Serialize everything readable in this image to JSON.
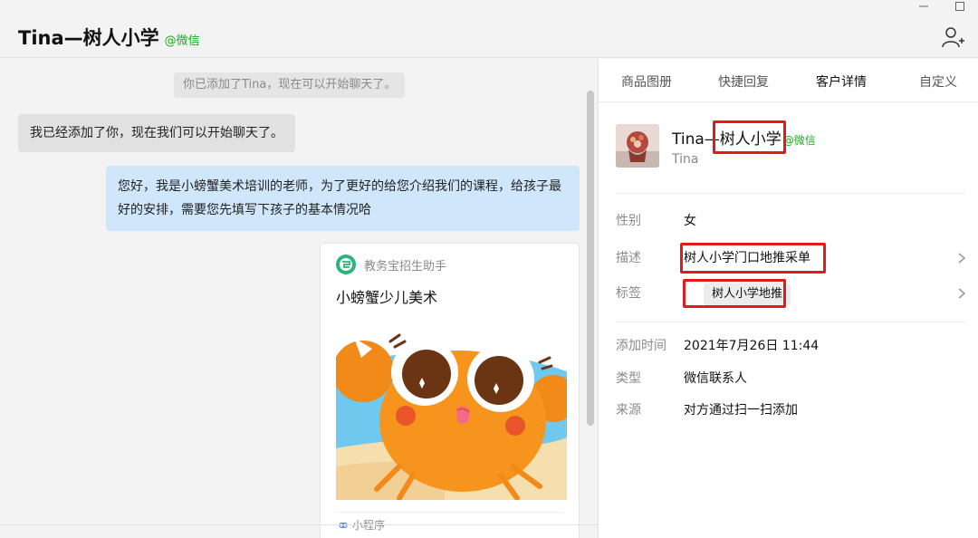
{
  "header": {
    "title": "Tina—树人小学",
    "tag": "@微信"
  },
  "chat": {
    "system_message": "你已添加了Tina，现在可以开始聊天了。",
    "incoming_message": "我已经添加了你，现在我们可以开始聊天了。",
    "outgoing_message": "您好，我是小螃蟹美术培训的老师，为了更好的给您介绍我们的课程，给孩子最好的安排，需要您先填写下孩子的基本情况哈",
    "card": {
      "source": "教务宝招生助手",
      "title": "小螃蟹少儿美术",
      "footer": "小程序"
    }
  },
  "panel": {
    "tabs": [
      "商品图册",
      "快捷回复",
      "客户详情",
      "自定义"
    ],
    "active_tab": "客户详情",
    "contact": {
      "name": "Tina—树人小学",
      "tag": "@微信",
      "sub": "Tina"
    },
    "details": {
      "gender_label": "性别",
      "gender": "女",
      "desc_label": "描述",
      "desc": "树人小学门口地推采单",
      "tags_label": "标签",
      "tag": "树人小学地推"
    },
    "meta": {
      "added_label": "添加时间",
      "added": "2021年7月26日 11:44",
      "type_label": "类型",
      "type": "微信联系人",
      "source_label": "来源",
      "source": "对方通过扫一扫添加"
    }
  },
  "colors": {
    "accent_green": "#1aad19",
    "bubble_out": "#cfe6fb",
    "highlight_red": "#e01b1b"
  },
  "icons": [
    "minimize-icon",
    "maximize-icon",
    "add-contact-icon",
    "mini-program-logo-icon",
    "chevron-right-icon"
  ]
}
